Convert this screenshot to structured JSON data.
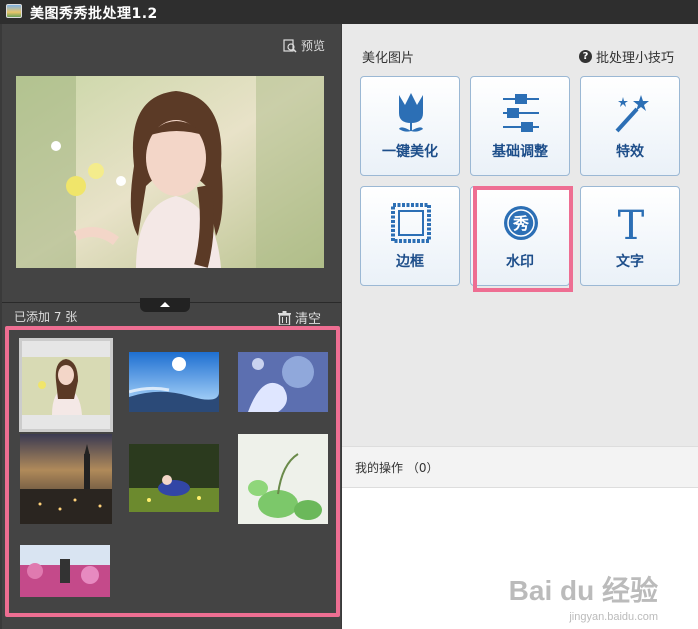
{
  "titlebar": {
    "title": "美图秀秀批处理1.2"
  },
  "left": {
    "preview_label": "预览",
    "added_label": "已添加 7 张",
    "clear_label": "清空"
  },
  "right": {
    "section_title": "美化图片",
    "tips_label": "批处理小技巧",
    "tools": [
      {
        "label": "一键美化",
        "icon": "tulip-icon"
      },
      {
        "label": "基础调整",
        "icon": "sliders-icon"
      },
      {
        "label": "特效",
        "icon": "magic-wand-icon"
      },
      {
        "label": "边框",
        "icon": "frame-icon"
      },
      {
        "label": "水印",
        "icon": "watermark-icon",
        "icon_text": "秀"
      },
      {
        "label": "文字",
        "icon": "text-icon",
        "icon_text": "T"
      }
    ],
    "ops_label": "我的操作 （0）"
  },
  "watermark": {
    "main": "Bai du 经验",
    "sub": "jingyan.baidu.com"
  },
  "colors": {
    "highlight": "#ee6e92",
    "tool_blue": "#2c6fb5"
  }
}
